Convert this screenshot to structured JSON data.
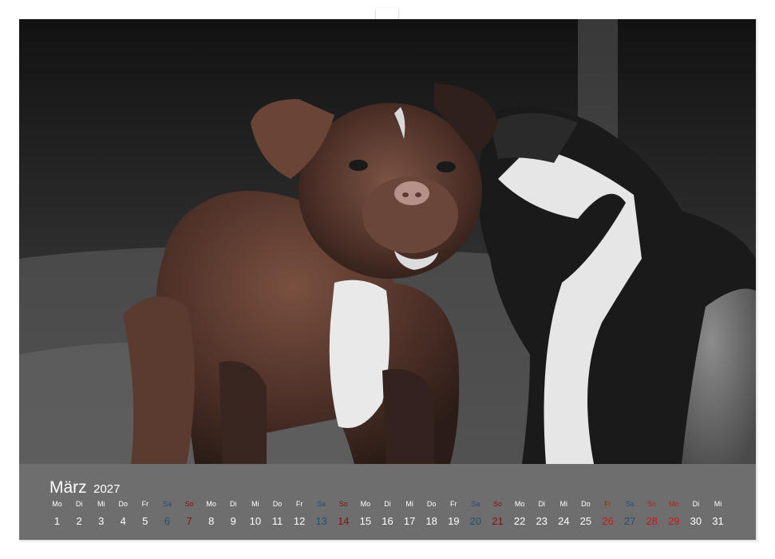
{
  "calendar": {
    "month": "März",
    "year": "2027",
    "days": [
      {
        "n": "Mo",
        "d": "1",
        "t": "wd"
      },
      {
        "n": "Di",
        "d": "2",
        "t": "wd"
      },
      {
        "n": "Mi",
        "d": "3",
        "t": "wd"
      },
      {
        "n": "Do",
        "d": "4",
        "t": "wd"
      },
      {
        "n": "Fr",
        "d": "5",
        "t": "wd"
      },
      {
        "n": "Sa",
        "d": "6",
        "t": "sat"
      },
      {
        "n": "So",
        "d": "7",
        "t": "sun"
      },
      {
        "n": "Mo",
        "d": "8",
        "t": "wd"
      },
      {
        "n": "Di",
        "d": "9",
        "t": "wd"
      },
      {
        "n": "Mi",
        "d": "10",
        "t": "wd"
      },
      {
        "n": "Do",
        "d": "11",
        "t": "wd"
      },
      {
        "n": "Fr",
        "d": "12",
        "t": "wd"
      },
      {
        "n": "Sa",
        "d": "13",
        "t": "sat"
      },
      {
        "n": "So",
        "d": "14",
        "t": "sun"
      },
      {
        "n": "Mo",
        "d": "15",
        "t": "wd"
      },
      {
        "n": "Di",
        "d": "16",
        "t": "wd"
      },
      {
        "n": "Mi",
        "d": "17",
        "t": "wd"
      },
      {
        "n": "Do",
        "d": "18",
        "t": "wd"
      },
      {
        "n": "Fr",
        "d": "19",
        "t": "wd"
      },
      {
        "n": "Sa",
        "d": "20",
        "t": "sat"
      },
      {
        "n": "So",
        "d": "21",
        "t": "sun"
      },
      {
        "n": "Mo",
        "d": "22",
        "t": "wd"
      },
      {
        "n": "Di",
        "d": "23",
        "t": "wd"
      },
      {
        "n": "Mi",
        "d": "24",
        "t": "wd"
      },
      {
        "n": "Do",
        "d": "25",
        "t": "wd"
      },
      {
        "n": "Fr",
        "d": "26",
        "t": "hol"
      },
      {
        "n": "Sa",
        "d": "27",
        "t": "sat"
      },
      {
        "n": "So",
        "d": "28",
        "t": "hol"
      },
      {
        "n": "Mo",
        "d": "29",
        "t": "hol"
      },
      {
        "n": "Di",
        "d": "30",
        "t": "wd"
      },
      {
        "n": "Mi",
        "d": "31",
        "t": "wd"
      }
    ]
  },
  "colors": {
    "calendar_band": "#6e6e6e",
    "weekday": "#ffffff",
    "saturday": "#1f4f7a",
    "sunday": "#8a1010",
    "holiday": "#c51a1a"
  },
  "photo": {
    "subject": "two bulldog puppies, brown-white and black-white"
  }
}
